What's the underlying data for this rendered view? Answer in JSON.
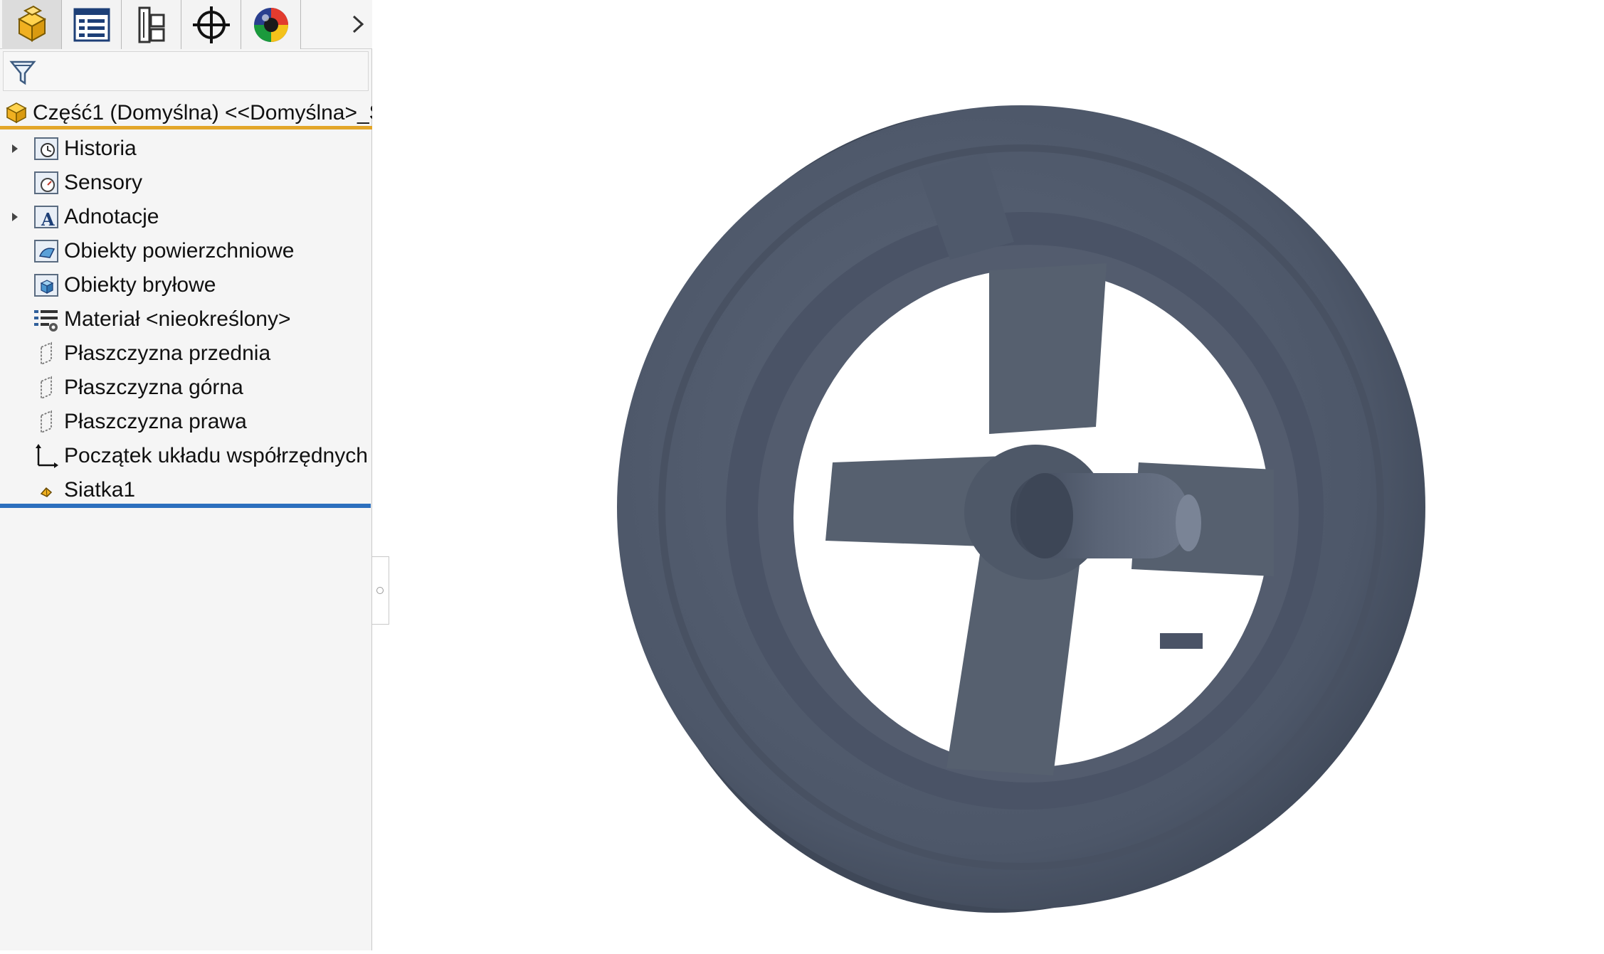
{
  "toolbar": {
    "tabs": [
      {
        "name": "featuremanager-tab",
        "icon": "part-icon",
        "active": true
      },
      {
        "name": "propertymanager-tab",
        "icon": "property-list-icon",
        "active": false
      },
      {
        "name": "configurationmanager-tab",
        "icon": "configuration-icon",
        "active": false
      },
      {
        "name": "dimxpert-tab",
        "icon": "crosshair-icon",
        "active": false
      },
      {
        "name": "displaymanager-tab",
        "icon": "appearance-sphere-icon",
        "active": false
      }
    ],
    "more_icon": "chevron-right-icon"
  },
  "filter": {
    "icon": "filter-icon",
    "value": ""
  },
  "tree": {
    "root_label": "Część1 (Domyślna) <<Domyślna>_S",
    "items": [
      {
        "label": "Historia",
        "icon": "history-folder-icon",
        "expandable": true
      },
      {
        "label": "Sensory",
        "icon": "sensors-folder-icon",
        "expandable": false
      },
      {
        "label": "Adnotacje",
        "icon": "annotations-folder-icon",
        "expandable": true
      },
      {
        "label": "Obiekty powierzchniowe",
        "icon": "surface-bodies-folder-icon",
        "expandable": false
      },
      {
        "label": "Obiekty bryłowe",
        "icon": "solid-bodies-folder-icon",
        "expandable": false
      },
      {
        "label": "Materiał <nieokreślony>",
        "icon": "material-icon",
        "expandable": false
      },
      {
        "label": "Płaszczyzna przednia",
        "icon": "plane-icon",
        "expandable": false
      },
      {
        "label": "Płaszczyzna górna",
        "icon": "plane-icon",
        "expandable": false
      },
      {
        "label": "Płaszczyzna prawa",
        "icon": "plane-icon",
        "expandable": false
      },
      {
        "label": "Początek układu współrzędnych",
        "icon": "origin-icon",
        "expandable": false
      },
      {
        "label": "Siatka1",
        "icon": "mesh-icon",
        "expandable": false
      }
    ]
  },
  "colors": {
    "accent_orange": "#e3a629",
    "rollback_blue": "#2c6fbe",
    "model_color": "#4f5a6c"
  },
  "viewport": {
    "model": "wheel-mesh-model"
  }
}
